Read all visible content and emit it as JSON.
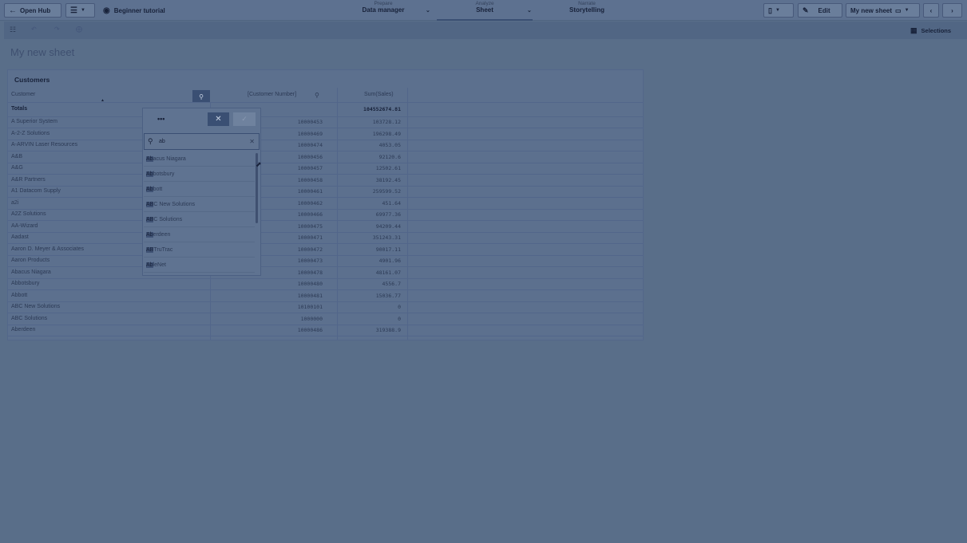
{
  "topbar": {
    "open_hub": "Open Hub",
    "app_name": "Beginner tutorial",
    "prepare_small": "Prepare",
    "prepare_label": "Data manager",
    "analyze_small": "Analyze",
    "analyze_label": "Sheet",
    "narrate_small": "Narrate",
    "narrate_label": "Storytelling",
    "edit_label": "Edit",
    "sheet_name": "My new sheet"
  },
  "toolbar": {
    "selections_label": "Selections"
  },
  "sheet": {
    "title": "My new sheet"
  },
  "table": {
    "title": "Customers",
    "headers": [
      "Customer",
      "[Customer Number]",
      "Sum(Sales)"
    ],
    "totals_label": "Totals",
    "totals_value": "104552674.81",
    "rows": [
      {
        "customer": "A Superior System",
        "number": "10000453",
        "sales": "103728.12"
      },
      {
        "customer": "A-2-Z Solutions",
        "number": "10000469",
        "sales": "196298.49"
      },
      {
        "customer": "A-ARVIN Laser Resources",
        "number": "10000474",
        "sales": "4053.05"
      },
      {
        "customer": "A&B",
        "number": "10000456",
        "sales": "92120.6"
      },
      {
        "customer": "A&G",
        "number": "10000457",
        "sales": "12502.61"
      },
      {
        "customer": "A&R Partners",
        "number": "10000458",
        "sales": "38192.45"
      },
      {
        "customer": "A1 Datacom Supply",
        "number": "10000461",
        "sales": "259599.52"
      },
      {
        "customer": "a2i",
        "number": "10000462",
        "sales": "451.64"
      },
      {
        "customer": "A2Z Solutions",
        "number": "10000466",
        "sales": "69977.36"
      },
      {
        "customer": "AA-Wizard",
        "number": "10000475",
        "sales": "94209.44"
      },
      {
        "customer": "Aadast",
        "number": "10000471",
        "sales": "351243.31"
      },
      {
        "customer": "Aaron D. Meyer & Associates",
        "number": "10000472",
        "sales": "90017.11"
      },
      {
        "customer": "Aaron Products",
        "number": "10000473",
        "sales": "4901.96"
      },
      {
        "customer": "Abacus Niagara",
        "number": "10000478",
        "sales": "48161.07"
      },
      {
        "customer": "Abbotsbury",
        "number": "10000480",
        "sales": "4556.7"
      },
      {
        "customer": "Abbott",
        "number": "10000481",
        "sales": "15036.77"
      },
      {
        "customer": "ABC New Solutions",
        "number": "10100101",
        "sales": "0"
      },
      {
        "customer": "ABC Solutions",
        "number": "1000000",
        "sales": "0"
      },
      {
        "customer": "Aberdeen",
        "number": "10000486",
        "sales": "319388.9"
      }
    ]
  },
  "popup": {
    "more_label": "•••",
    "search_value": "ab",
    "items": [
      {
        "hl": "Ab",
        "rest": "acus Niagara"
      },
      {
        "hl": "Ab",
        "rest": "botsbury"
      },
      {
        "hl": "Ab",
        "rest": "bott"
      },
      {
        "hl": "AB",
        "rest": "C New Solutions"
      },
      {
        "hl": "AB",
        "rest": "C Solutions"
      },
      {
        "hl": "Ab",
        "rest": "erdeen"
      },
      {
        "hl": "AB",
        "rest": " TruTrac"
      },
      {
        "hl": "Ab",
        "rest": "leNet"
      }
    ]
  }
}
